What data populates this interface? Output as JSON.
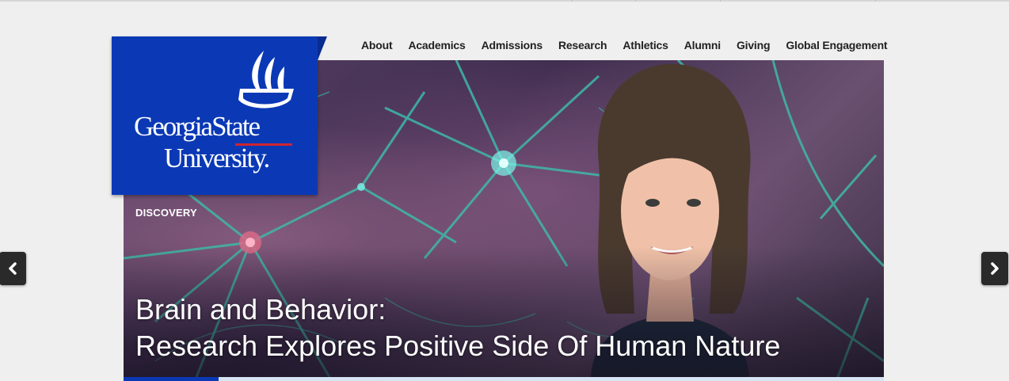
{
  "nav": {
    "items": [
      {
        "label": "About"
      },
      {
        "label": "Academics"
      },
      {
        "label": "Admissions"
      },
      {
        "label": "Research"
      },
      {
        "label": "Athletics"
      },
      {
        "label": "Alumni"
      },
      {
        "label": "Giving"
      },
      {
        "label": "Global Engagement"
      }
    ]
  },
  "logo": {
    "line1": "GeorgiaState",
    "line2": "University.",
    "icon": "flame-icon",
    "brand_color": "#0b39b5",
    "accent_color": "#d1242f"
  },
  "slide": {
    "category": "DISCOVERY",
    "headline_line1": "Brain and Behavior:",
    "headline_line2": "Research Explores Positive Side Of Human Nature",
    "progress": 0.125
  },
  "controls": {
    "prev_icon": "chevron-left-icon",
    "next_icon": "chevron-right-icon"
  }
}
